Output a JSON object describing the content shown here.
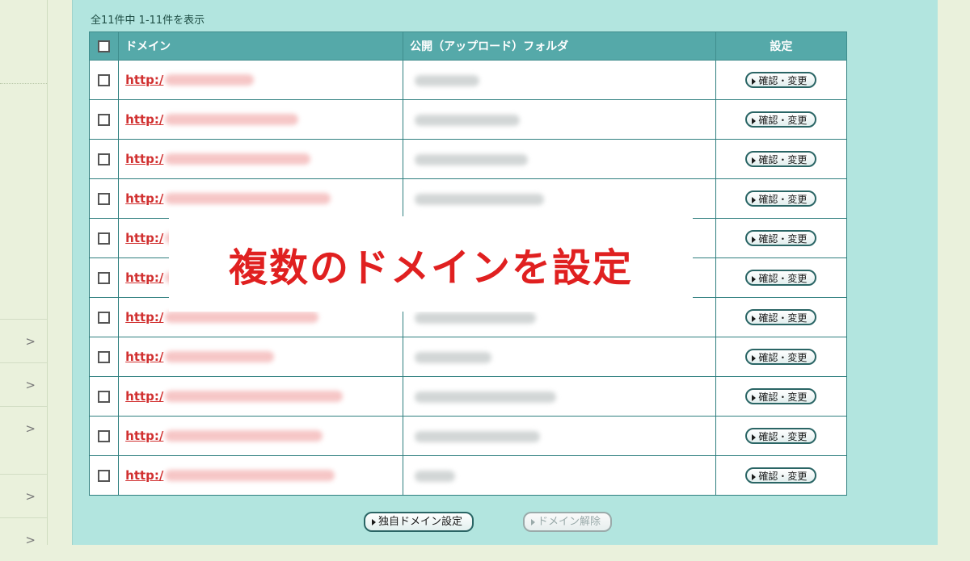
{
  "sidebar": {
    "items": [
      {
        "chevron": ">"
      },
      {
        "chevron": ">"
      },
      {
        "chevron": ">"
      },
      {
        "chevron": ">"
      },
      {
        "chevron": ">"
      }
    ]
  },
  "summary": {
    "text": "全11件中 1-11件を表示"
  },
  "table": {
    "headers": {
      "domain": "ドメイン",
      "folder": "公開（アップロード）フォルダ",
      "setting": "設定"
    },
    "rows": [
      {
        "domain_prefix": "http:/",
        "action": "確認・変更"
      },
      {
        "domain_prefix": "http:/",
        "action": "確認・変更"
      },
      {
        "domain_prefix": "http:/",
        "action": "確認・変更"
      },
      {
        "domain_prefix": "http:/",
        "action": "確認・変更"
      },
      {
        "domain_prefix": "http:/",
        "action": "確認・変更"
      },
      {
        "domain_prefix": "http:/",
        "action": "確認・変更"
      },
      {
        "domain_prefix": "http:/",
        "action": "確認・変更"
      },
      {
        "domain_prefix": "http:/",
        "action": "確認・変更"
      },
      {
        "domain_prefix": "http:/",
        "action": "確認・変更"
      },
      {
        "domain_prefix": "http:/",
        "action": "確認・変更"
      },
      {
        "domain_prefix": "http:/",
        "action": "確認・変更"
      }
    ]
  },
  "actions": {
    "set_domain": "独自ドメイン設定",
    "remove_domain": "ドメイン解除"
  },
  "overlay": {
    "text": "複数のドメインを設定"
  },
  "colors": {
    "panel": "#b2e5df",
    "header": "#55a9a9",
    "link": "#d13030",
    "overlay_text": "#e02020"
  }
}
